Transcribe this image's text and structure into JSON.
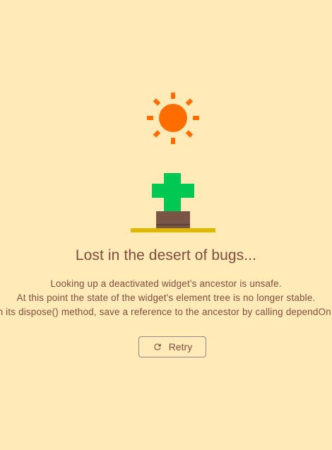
{
  "error": {
    "title": "Lost in the desert of bugs...",
    "message_lines": [
      "Looking up a deactivated widget's ancestor is unsafe.",
      "At this point the state of the widget's element tree is no longer stable.",
      "To safely refer to a widget's ancestor in its dispose() method, save a reference to the ancestor by calling dependOnInheritedWidgetOfExactType() in the widget's didChangeDependencies() method."
    ]
  },
  "actions": {
    "retry_label": "Retry",
    "retry_icon": "refresh-icon"
  },
  "illustration": {
    "sun_icon": "sun-icon",
    "cactus_icon": "cactus-icon"
  },
  "colors": {
    "background": "#ffeab8",
    "text": "#7d4c3c",
    "sun": "#ff6d00",
    "cactus": "#00c853",
    "pot": "#795548",
    "ground": "#e0b800"
  }
}
